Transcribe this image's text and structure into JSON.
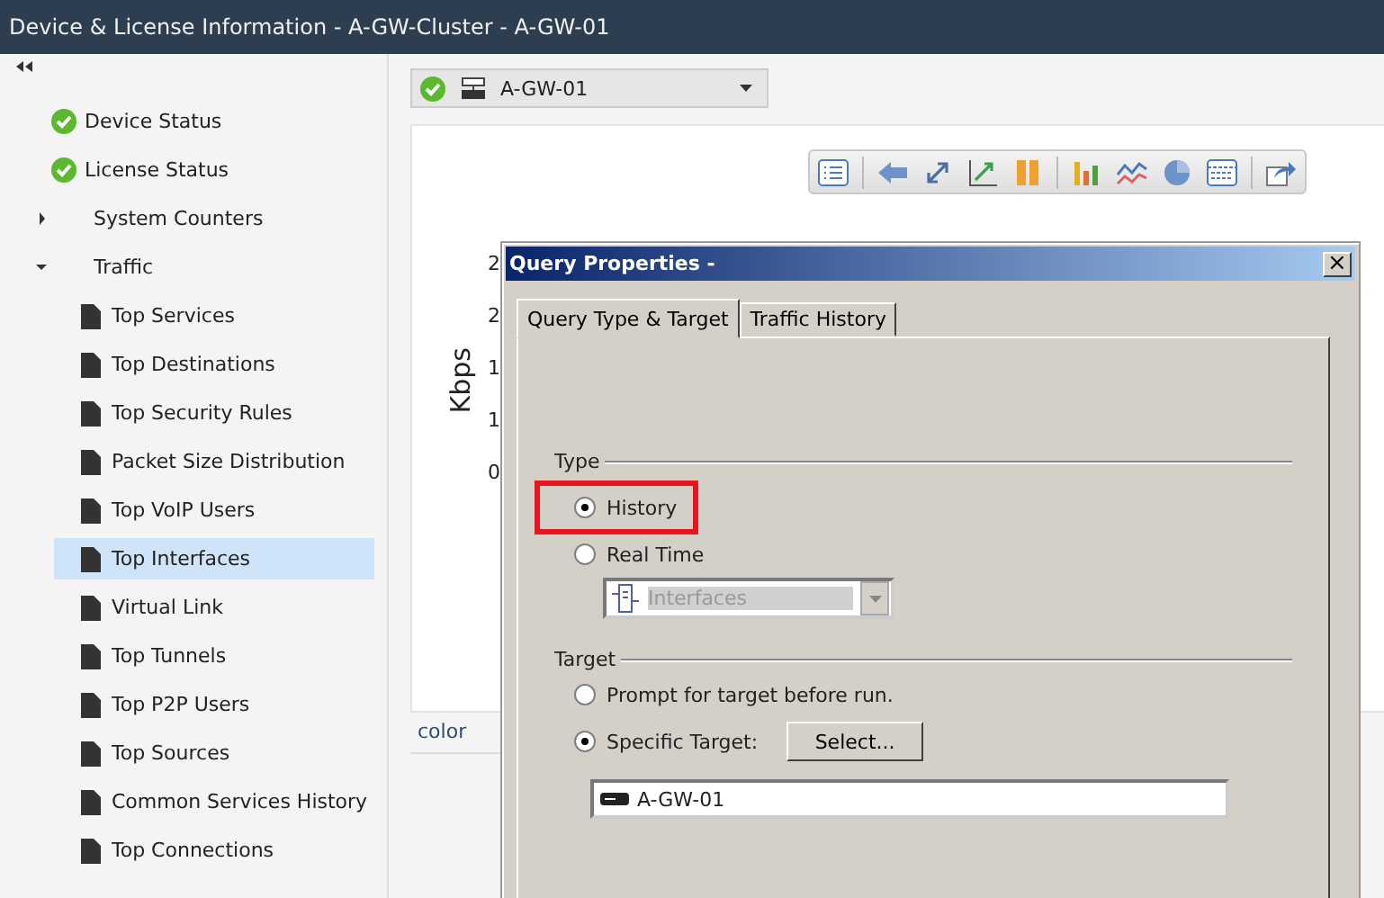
{
  "window": {
    "title": "Device & License Information - A-GW-Cluster - A-GW-01"
  },
  "sidebar": {
    "items": [
      {
        "label": "Device Status",
        "kind": "status",
        "selected": false
      },
      {
        "label": "License Status",
        "kind": "status",
        "selected": false
      },
      {
        "label": "System Counters",
        "kind": "group",
        "expanded": false,
        "selected": false
      },
      {
        "label": "Traffic",
        "kind": "group",
        "expanded": true,
        "selected": false,
        "children": [
          {
            "label": "Top Services",
            "selected": false
          },
          {
            "label": "Top Destinations",
            "selected": false
          },
          {
            "label": "Top Security Rules",
            "selected": false
          },
          {
            "label": "Packet Size Distribution",
            "selected": false
          },
          {
            "label": "Top VoIP Users",
            "selected": false
          },
          {
            "label": "Top Interfaces",
            "selected": true
          },
          {
            "label": "Virtual Link",
            "selected": false
          },
          {
            "label": "Top Tunnels",
            "selected": false
          },
          {
            "label": "Top P2P Users",
            "selected": false
          },
          {
            "label": "Top Sources",
            "selected": false
          },
          {
            "label": "Common Services History",
            "selected": false
          },
          {
            "label": "Top Connections",
            "selected": false
          }
        ]
      }
    ]
  },
  "device_selector": {
    "value": "A-GW-01"
  },
  "chart": {
    "ylabel": "Kbps",
    "yticks": [
      "2",
      "2",
      "1",
      "1",
      "0"
    ]
  },
  "table": {
    "columns": [
      "color"
    ]
  },
  "dialog": {
    "title": "Query Properties -",
    "close": "×",
    "tabs": [
      {
        "label": "Query Type & Target",
        "selected": true
      },
      {
        "label": "Traffic History",
        "selected": false
      }
    ],
    "type_group": {
      "legend": "Type",
      "options": [
        {
          "label": "History",
          "selected": true,
          "highlighted": true
        },
        {
          "label": "Real Time",
          "selected": false,
          "highlighted": false
        }
      ],
      "realtime_combo": {
        "value": "Interfaces",
        "disabled": true
      }
    },
    "target_group": {
      "legend": "Target",
      "options": [
        {
          "label": "Prompt for target before run.",
          "selected": false
        },
        {
          "label": "Specific Target:",
          "selected": true
        }
      ],
      "select_button": "Select...",
      "target_field": "A-GW-01"
    }
  }
}
